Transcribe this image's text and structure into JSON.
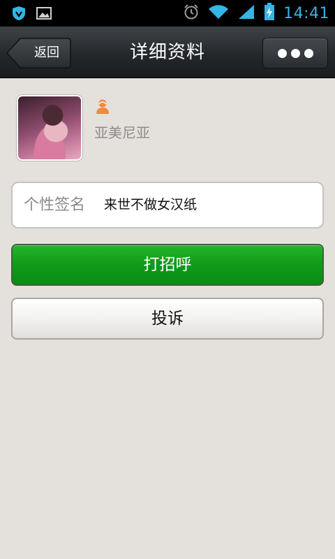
{
  "status_bar": {
    "time": "14:41",
    "left_icons": [
      "shield-notification-icon",
      "image-notification-icon"
    ],
    "right_icons": [
      "alarm-icon",
      "wifi-icon",
      "signal-icon",
      "battery-charging-icon"
    ],
    "accent": "#33b5e5"
  },
  "header": {
    "back_label": "返回",
    "title": "详细资料",
    "more_icon": "more-dots-icon"
  },
  "profile": {
    "username": "亚美尼亚",
    "gender_icon": "female-user-icon",
    "gender_color": "#f08a3c"
  },
  "signature": {
    "label": "个性签名",
    "value": "来世不做女汉纸"
  },
  "actions": {
    "greet_label": "打招呼",
    "report_label": "投诉",
    "greet_color": "#17a322"
  }
}
